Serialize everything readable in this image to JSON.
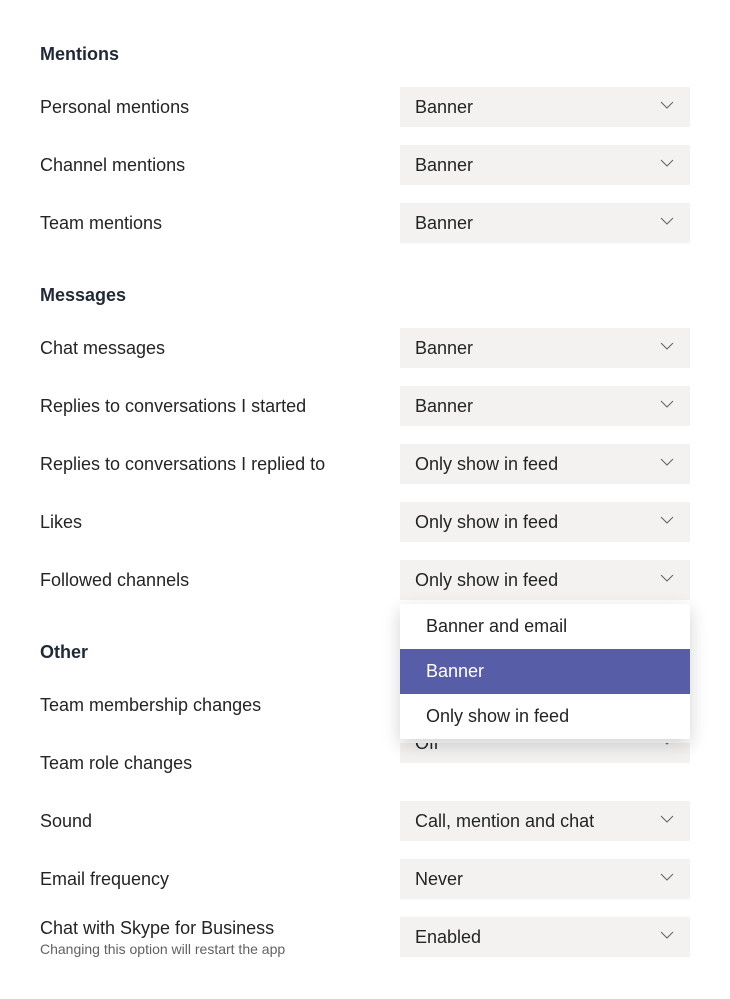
{
  "sections": {
    "mentions": {
      "heading": "Mentions",
      "items": [
        {
          "label": "Personal mentions",
          "value": "Banner"
        },
        {
          "label": "Channel mentions",
          "value": "Banner"
        },
        {
          "label": "Team mentions",
          "value": "Banner"
        }
      ]
    },
    "messages": {
      "heading": "Messages",
      "items": [
        {
          "label": "Chat messages",
          "value": "Banner"
        },
        {
          "label": "Replies to conversations I started",
          "value": "Banner"
        },
        {
          "label": "Replies to conversations I replied to",
          "value": "Only show in feed"
        },
        {
          "label": "Likes",
          "value": "Only show in feed"
        },
        {
          "label": "Followed channels",
          "value": "Only show in feed",
          "open": true
        }
      ]
    },
    "other": {
      "heading": "Other",
      "items": [
        {
          "label": "Team membership changes",
          "value": ""
        },
        {
          "label": "Team role changes",
          "value": "Off"
        },
        {
          "label": "Sound",
          "value": "Call, mention and chat"
        },
        {
          "label": "Email frequency",
          "value": "Never"
        },
        {
          "label": "Chat with Skype for Business",
          "sublabel": "Changing this option will restart the app",
          "value": "Enabled"
        }
      ]
    }
  },
  "dropdown_options": [
    "Banner and email",
    "Banner",
    "Only show in feed"
  ],
  "dropdown_selected": "Banner"
}
